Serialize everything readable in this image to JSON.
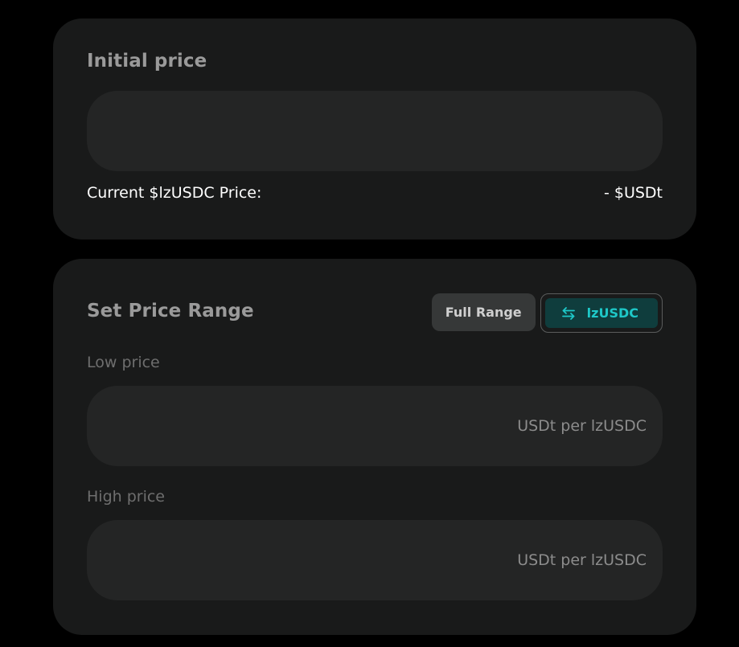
{
  "initial_price": {
    "title": "Initial price",
    "input_value": "",
    "current_label": "Current $lzUSDC Price:",
    "current_value": "- $USDt"
  },
  "price_range": {
    "title": "Set Price Range",
    "full_range_label": "Full Range",
    "token_toggle_label": "lzUSDC",
    "token_toggle_icon": "swap-arrows-icon",
    "low": {
      "label": "Low price",
      "value": "",
      "suffix": "USDt per lzUSDC"
    },
    "high": {
      "label": "High price",
      "value": "",
      "suffix": "USDt per lzUSDC"
    }
  },
  "colors": {
    "background": "#000000",
    "card": "#191a1a",
    "field": "#242525",
    "accent": "#1ec8c8",
    "accent_bg": "#0f3d3d"
  }
}
